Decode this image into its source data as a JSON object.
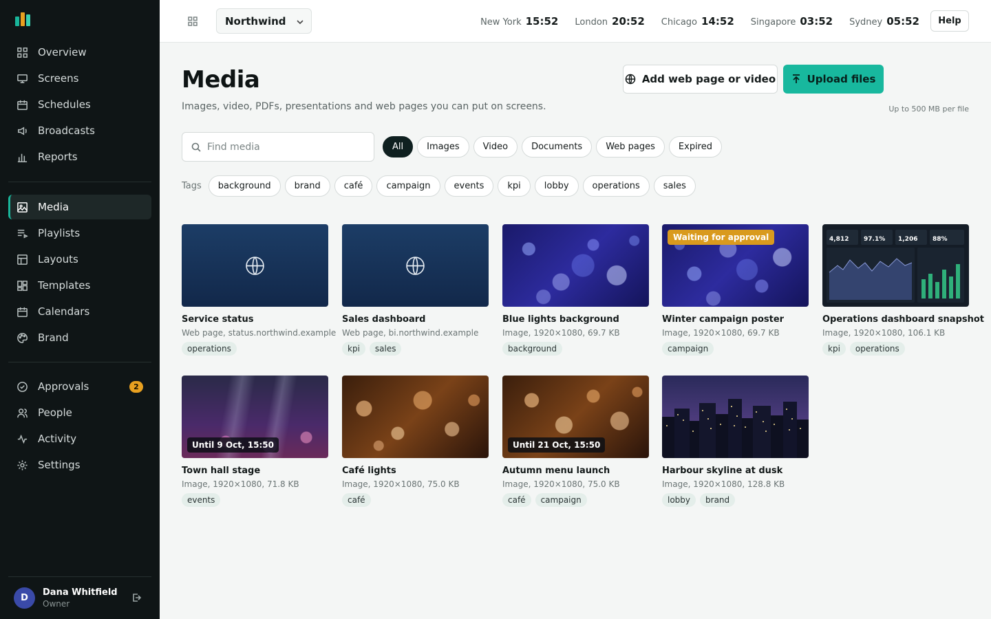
{
  "sidebar": {
    "logo_colors": [
      "#19b59a",
      "#e8a020",
      "#3ad0b0"
    ],
    "group1": [
      {
        "label": "Overview",
        "icon": "grid-icon"
      },
      {
        "label": "Screens",
        "icon": "monitor-icon"
      },
      {
        "label": "Schedules",
        "icon": "calendar-icon"
      },
      {
        "label": "Broadcasts",
        "icon": "megaphone-icon"
      },
      {
        "label": "Reports",
        "icon": "bar-chart-icon"
      }
    ],
    "group2": [
      {
        "label": "Media",
        "icon": "image-icon"
      },
      {
        "label": "Playlists",
        "icon": "playlist-icon"
      },
      {
        "label": "Layouts",
        "icon": "layout-icon"
      },
      {
        "label": "Templates",
        "icon": "templates-icon"
      },
      {
        "label": "Calendars",
        "icon": "calendar-icon"
      },
      {
        "label": "Brand",
        "icon": "palette-icon"
      }
    ],
    "group3": [
      {
        "label": "Approvals",
        "icon": "check-circle-icon",
        "badge": "2"
      },
      {
        "label": "People",
        "icon": "people-icon"
      },
      {
        "label": "Activity",
        "icon": "activity-icon"
      },
      {
        "label": "Settings",
        "icon": "gear-icon"
      }
    ],
    "user": {
      "initial": "D",
      "name": "Dana Whitfield",
      "role": "Owner"
    }
  },
  "topbar": {
    "org": "Northwind",
    "clocks": [
      {
        "city": "New York",
        "time": "15:52"
      },
      {
        "city": "London",
        "time": "20:52"
      },
      {
        "city": "Chicago",
        "time": "14:52"
      },
      {
        "city": "Singapore",
        "time": "03:52"
      },
      {
        "city": "Sydney",
        "time": "05:52"
      }
    ],
    "help": "Help"
  },
  "main": {
    "title": "Media",
    "subtitle": "Images, video, PDFs, presentations and web pages you can put on screens.",
    "add_web": "Add web page or video",
    "upload": "Upload files",
    "upload_note": "Up to 500 MB per file",
    "search_placeholder": "Find media",
    "filters": [
      "All",
      "Images",
      "Video",
      "Documents",
      "Web pages",
      "Expired"
    ],
    "tags_label": "Tags",
    "tags": [
      "background",
      "brand",
      "café",
      "campaign",
      "events",
      "kpi",
      "lobby",
      "operations",
      "sales"
    ]
  },
  "cards": [
    {
      "title": "Service status",
      "meta": "Web page, status.northwind.example",
      "tags": [
        "operations"
      ],
      "kind": "web"
    },
    {
      "title": "Sales dashboard",
      "meta": "Web page, bi.northwind.example",
      "tags": [
        "kpi",
        "sales"
      ],
      "kind": "web"
    },
    {
      "title": "Blue lights background",
      "meta": "Image, 1920×1080, 69.7 KB",
      "tags": [
        "background"
      ],
      "kind": "bokeh-blue"
    },
    {
      "title": "Winter campaign poster",
      "meta": "Image, 1920×1080, 69.7 KB",
      "tags": [
        "campaign"
      ],
      "kind": "bokeh-blue",
      "badge": "Waiting for approval"
    },
    {
      "title": "Operations dashboard snapshot",
      "meta": "Image, 1920×1080, 106.1 KB",
      "tags": [
        "kpi",
        "operations"
      ],
      "kind": "dashboard",
      "kpis": [
        "4,812",
        "97.1%",
        "1,206",
        "88%"
      ]
    },
    {
      "title": "Town hall stage",
      "meta": "Image, 1920×1080, 71.8 KB",
      "tags": [
        "events"
      ],
      "kind": "stage",
      "until": "Until 9 Oct, 15:50"
    },
    {
      "title": "Café lights",
      "meta": "Image, 1920×1080, 75.0 KB",
      "tags": [
        "café"
      ],
      "kind": "bokeh-warm"
    },
    {
      "title": "Autumn menu launch",
      "meta": "Image, 1920×1080, 75.0 KB",
      "tags": [
        "café",
        "campaign"
      ],
      "kind": "bokeh-warm",
      "until": "Until 21 Oct, 15:50"
    },
    {
      "title": "Harbour skyline at dusk",
      "meta": "Image, 1920×1080, 128.8 KB",
      "tags": [
        "lobby",
        "brand"
      ],
      "kind": "skyline"
    }
  ]
}
